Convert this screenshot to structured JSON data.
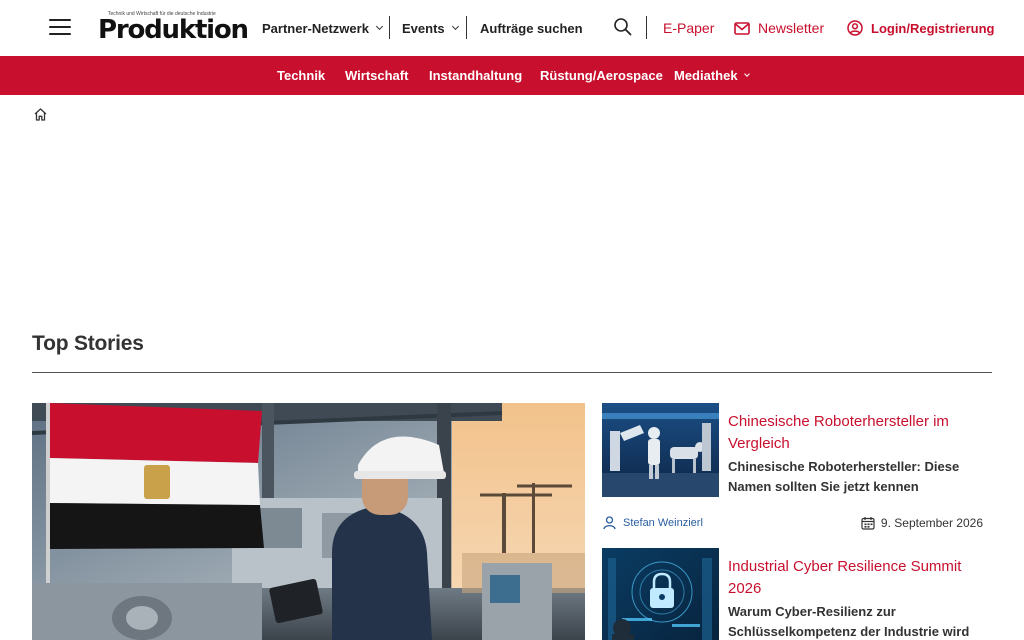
{
  "header": {
    "menu_icon": "hamburger-menu-icon",
    "logo_tagline": "Technik und Wirtschaft für die deutsche Industrie",
    "logo_text": "Produktion",
    "nav": [
      {
        "label": "Partner-Netzwerk",
        "has_dropdown": true
      },
      {
        "label": "Events",
        "has_dropdown": true
      },
      {
        "label": "Aufträge suchen",
        "has_dropdown": false
      }
    ],
    "search_icon": "search-icon",
    "epaper_label": "E-Paper",
    "newsletter_label": "Newsletter",
    "newsletter_icon": "envelope-icon",
    "login_label": "Login/Registrierung",
    "login_icon": "user-circle-icon",
    "accent_color": "#c8102e"
  },
  "main_nav": {
    "items": [
      {
        "label": "Technik",
        "has_dropdown": false
      },
      {
        "label": "Wirtschaft",
        "has_dropdown": false
      },
      {
        "label": "Instandhaltung",
        "has_dropdown": false
      },
      {
        "label": "Rüstung/Aerospace",
        "has_dropdown": false
      },
      {
        "label": "Mediathek",
        "has_dropdown": true
      }
    ],
    "background_color": "#c8102e"
  },
  "breadcrumb": {
    "home_icon": "home-icon"
  },
  "top_stories": {
    "heading": "Top Stories",
    "hero": {
      "image_description": "Engineer in hard hat with tablet in a factory hall, Egyptian flag, port cranes at sunset"
    },
    "stories": [
      {
        "title": "Chinesische Roboterhersteller im Vergleich",
        "subtitle": "Chinesische Roboterhersteller: Diese Namen sollten Sie jetzt kennen",
        "author": "Stefan Weinzierl",
        "date": "9. September 2026",
        "image_description": "Humanoid and quadruped robots in a blue-lit factory"
      },
      {
        "title": "Industrial Cyber Resilience Summit 2026",
        "subtitle": "Warum Cyber-Resilienz zur Schlüsselkompetenz der Industrie wird",
        "image_description": "Digital padlock hologram over a server room"
      }
    ]
  }
}
